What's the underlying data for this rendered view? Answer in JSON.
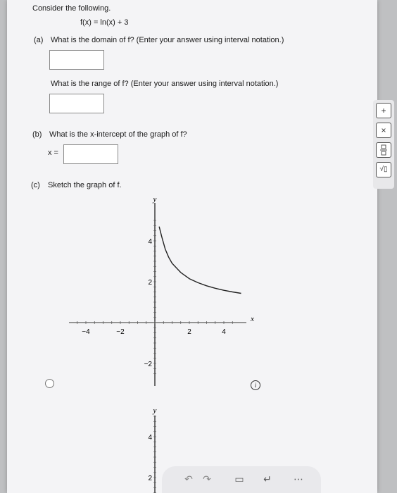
{
  "problem": {
    "intro": "Consider the following.",
    "function": "f(x) = ln(x) + 3"
  },
  "part_a": {
    "label": "(a)",
    "domain_question": "What is the domain of f? (Enter your answer using interval notation.)",
    "range_question": "What is the range of f? (Enter your answer using interval notation.)"
  },
  "part_b": {
    "label": "(b)",
    "question": "What is the x-intercept of the graph of f?",
    "prefix": "x ="
  },
  "part_c": {
    "label": "(c)",
    "question": "Sketch the graph of f."
  },
  "side_toolbar": {
    "plus": "+",
    "times": "×",
    "fraction_icon": "fraction-icon",
    "sqrt": "√▯"
  },
  "info_icon": "i",
  "chart_data": [
    {
      "type": "line",
      "xlabel": "x",
      "ylabel": "y",
      "xlim": [
        -5,
        5
      ],
      "ylim": [
        -2.5,
        5
      ],
      "x_ticks": [
        "-4",
        "-2",
        "2",
        "4"
      ],
      "y_ticks": [
        "4",
        "2",
        "-2"
      ],
      "series": [
        {
          "x": [
            0.25,
            0.4,
            0.6,
            0.8,
            1,
            1.5,
            2,
            2.5,
            3,
            3.5,
            4,
            4.5,
            5
          ],
          "y": [
            4.7,
            4.2,
            3.6,
            3.2,
            2.9,
            2.45,
            2.15,
            1.95,
            1.8,
            1.68,
            1.58,
            1.5,
            1.43
          ]
        }
      ]
    },
    {
      "type": "line",
      "ylabel": "y",
      "y_ticks": [
        "4",
        "2"
      ]
    }
  ]
}
